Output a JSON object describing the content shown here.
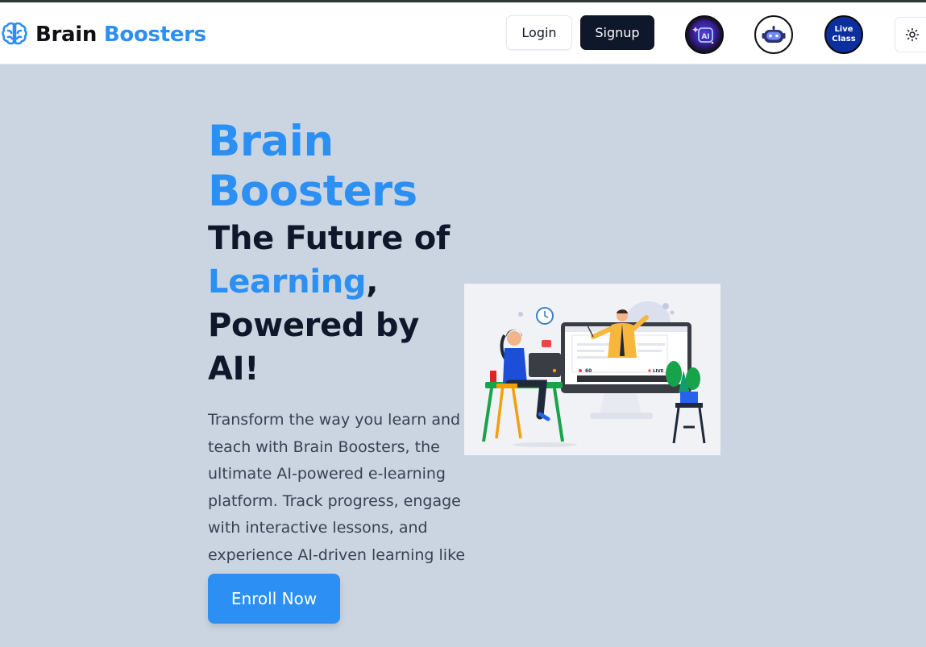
{
  "navbar": {
    "brand_part1": "Brain",
    "brand_part2": "Boosters",
    "login_label": "Login",
    "signup_label": "Signup",
    "ai_badge_text": "AI",
    "live_class_line1": "Live",
    "live_class_line2": "Class"
  },
  "hero": {
    "brand_line1": "Brain",
    "brand_line2": "Boosters",
    "tagline_part1": "The Future of",
    "tagline_highlight": "Learning",
    "tagline_part2": ",",
    "tagline_part3": "Powered by AI!",
    "description": "Transform the way you learn and teach with Brain Boosters, the ultimate AI-powered e-learning platform. Track progress, engage with interactive lessons, and experience AI-driven learning like never before.",
    "enroll_label": "Enroll Now"
  },
  "illustration": {
    "viewer_count": "60",
    "live_label": "LIVE"
  },
  "colors": {
    "accent": "#2b8ff4",
    "dark": "#0f172a",
    "page_background": "#cbd5e1"
  },
  "icons": [
    "brain-icon",
    "ai-sparkle-icon",
    "robot-icon",
    "sun-icon"
  ]
}
